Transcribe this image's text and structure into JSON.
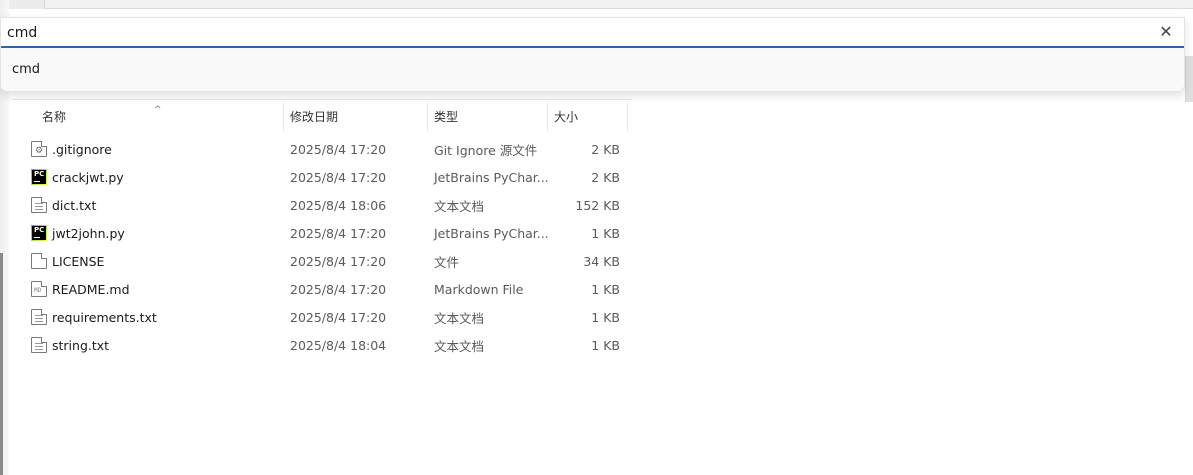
{
  "command_bar": {
    "input_value": "cmd",
    "clear_label": "✕",
    "suggestion": "cmd"
  },
  "columns": {
    "name": "名称",
    "date": "修改日期",
    "type": "类型",
    "size": "大小",
    "sort_indicator": "^"
  },
  "files": [
    {
      "name": ".gitignore",
      "date": "2025/8/4 17:20",
      "type": "Git Ignore 源文件",
      "size": "2 KB",
      "icon": "gear-file-icon"
    },
    {
      "name": "crackjwt.py",
      "date": "2025/8/4 17:20",
      "type": "JetBrains PyChar...",
      "size": "2 KB",
      "icon": "pycharm-icon"
    },
    {
      "name": "dict.txt",
      "date": "2025/8/4 18:06",
      "type": "文本文档",
      "size": "152 KB",
      "icon": "text-file-icon"
    },
    {
      "name": "jwt2john.py",
      "date": "2025/8/4 17:20",
      "type": "JetBrains PyChar...",
      "size": "1 KB",
      "icon": "pycharm-icon"
    },
    {
      "name": "LICENSE",
      "date": "2025/8/4 17:20",
      "type": "文件",
      "size": "34 KB",
      "icon": "blank-file-icon"
    },
    {
      "name": "README.md",
      "date": "2025/8/4 17:20",
      "type": "Markdown File",
      "size": "1 KB",
      "icon": "markdown-file-icon"
    },
    {
      "name": "requirements.txt",
      "date": "2025/8/4 17:20",
      "type": "文本文档",
      "size": "1 KB",
      "icon": "text-file-icon"
    },
    {
      "name": "string.txt",
      "date": "2025/8/4 18:04",
      "type": "文本文档",
      "size": "1 KB",
      "icon": "text-file-icon"
    }
  ],
  "colors": {
    "accent": "#2a63b0",
    "pycharm_green": "#21d789"
  }
}
